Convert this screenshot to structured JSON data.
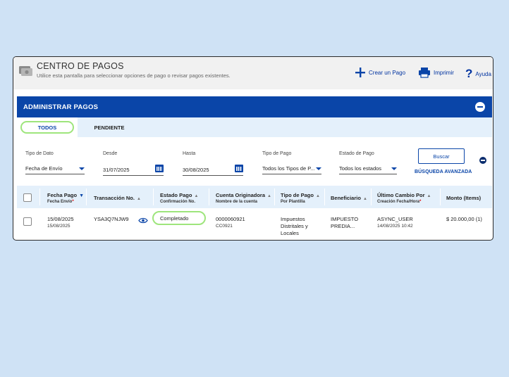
{
  "header": {
    "title": "CENTRO DE PAGOS",
    "subtitle": "Utilice esta pantalla para seleccionar opciones de pago o revisar pagos existentes.",
    "actions": {
      "create": "Crear un Pago",
      "print": "Imprimir",
      "help": "Ayuda"
    }
  },
  "section": {
    "title": "ADMINISTRAR PAGOS"
  },
  "tabs": [
    {
      "label": "TODOS",
      "active": true
    },
    {
      "label": "PENDIENTE",
      "active": false
    }
  ],
  "filters": {
    "tipo_dato": {
      "label": "Tipo de Dato",
      "value": "Fecha de Envío"
    },
    "desde": {
      "label": "Desde",
      "value": "31/07/2025"
    },
    "hasta": {
      "label": "Hasta",
      "value": "30/08/2025"
    },
    "tipo_pago": {
      "label": "Tipo de Pago",
      "value": "Todos los Tipos de P..."
    },
    "estado_pago": {
      "label": "Estado de Pago",
      "value": "Todos los estados"
    },
    "search_button": "Buscar",
    "advanced_search": "BÚSQUEDA AVANZADA"
  },
  "table": {
    "columns": {
      "fecha_pago": {
        "label": "Fecha Pago",
        "sub": "Fecha Envío"
      },
      "transaccion": {
        "label": "Transacción No."
      },
      "estado": {
        "label": "Estado Pago",
        "sub": "Confirmación No."
      },
      "cuenta": {
        "label": "Cuenta Originadora",
        "sub": "Nombre de la cuenta"
      },
      "tipo": {
        "label": "Tipo de Pago",
        "sub": "Por Plantilla"
      },
      "beneficiario": {
        "label": "Beneficiario"
      },
      "ultimo": {
        "label": "Último Cambio Por",
        "sub": "Creación Fecha/Hora"
      },
      "monto": {
        "label": "Monto (Items)"
      }
    },
    "rows": [
      {
        "fecha_pago": "15/08/2025",
        "fecha_envio": "15/08/2025",
        "transaccion": "YSA3Q7NJW9",
        "estado": "Completado",
        "cuenta": "0000060921",
        "cuenta_nombre": "CC0921",
        "tipo_line1": "Impuestos",
        "tipo_line2": "Distritales y",
        "tipo_line3": "Locales",
        "beneficiario_line1": "IMPUESTO",
        "beneficiario_line2": "PREDIA...",
        "ultimo": "ASYNC_USER",
        "creacion": "14/08/2025 10:42",
        "monto": "$ 20.000,00 (1)"
      }
    ]
  },
  "colors": {
    "brand": "#0a45a8",
    "highlight": "#9ee57c",
    "page_bg": "#cfe2f5"
  }
}
